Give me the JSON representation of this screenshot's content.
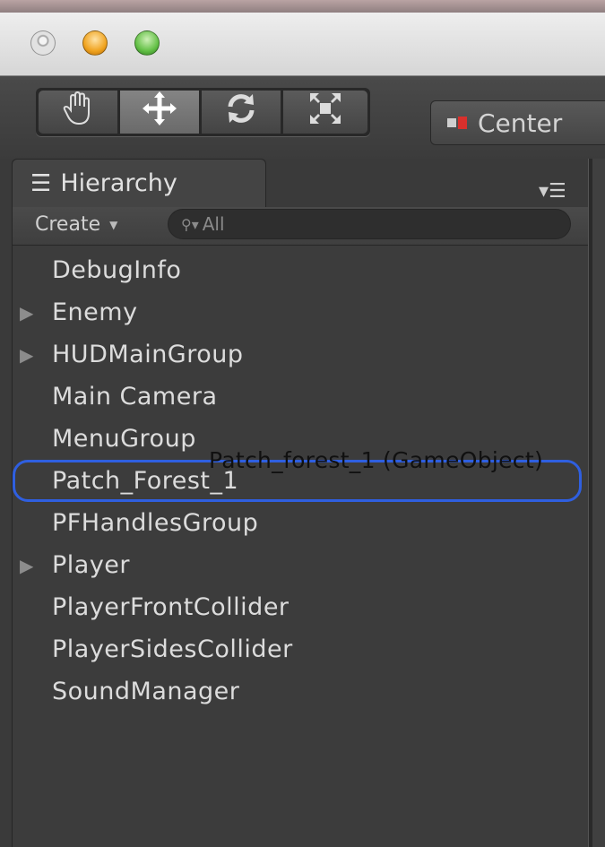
{
  "window": {
    "controls": [
      "close",
      "minimize",
      "maximize"
    ]
  },
  "toolbar": {
    "tools": [
      {
        "name": "hand",
        "icon": "hand-icon",
        "active": false
      },
      {
        "name": "move",
        "icon": "move-arrows-icon",
        "active": true
      },
      {
        "name": "rotate",
        "icon": "rotate-icon",
        "active": false
      },
      {
        "name": "scale",
        "icon": "scale-icon",
        "active": false
      }
    ],
    "pivot_label": "Center"
  },
  "hierarchy": {
    "tab_label": "Hierarchy",
    "create_label": "Create",
    "search_placeholder": "All",
    "items": [
      {
        "label": "DebugInfo",
        "expandable": false
      },
      {
        "label": "Enemy",
        "expandable": true
      },
      {
        "label": "HUDMainGroup",
        "expandable": true
      },
      {
        "label": "Main Camera",
        "expandable": false
      },
      {
        "label": "MenuGroup",
        "expandable": false
      },
      {
        "label": "Patch_Forest_1",
        "expandable": false,
        "drop_target": true
      },
      {
        "label": "PFHandlesGroup",
        "expandable": false
      },
      {
        "label": "Player",
        "expandable": true
      },
      {
        "label": "PlayerFrontCollider",
        "expandable": false
      },
      {
        "label": "PlayerSidesCollider",
        "expandable": false
      },
      {
        "label": "SoundManager",
        "expandable": false
      }
    ],
    "drag_ghost": "Patch_forest_1 (GameObject)"
  },
  "colors": {
    "drop_highlight": "#2f5fe0",
    "pivot_red": "#d9302c"
  }
}
